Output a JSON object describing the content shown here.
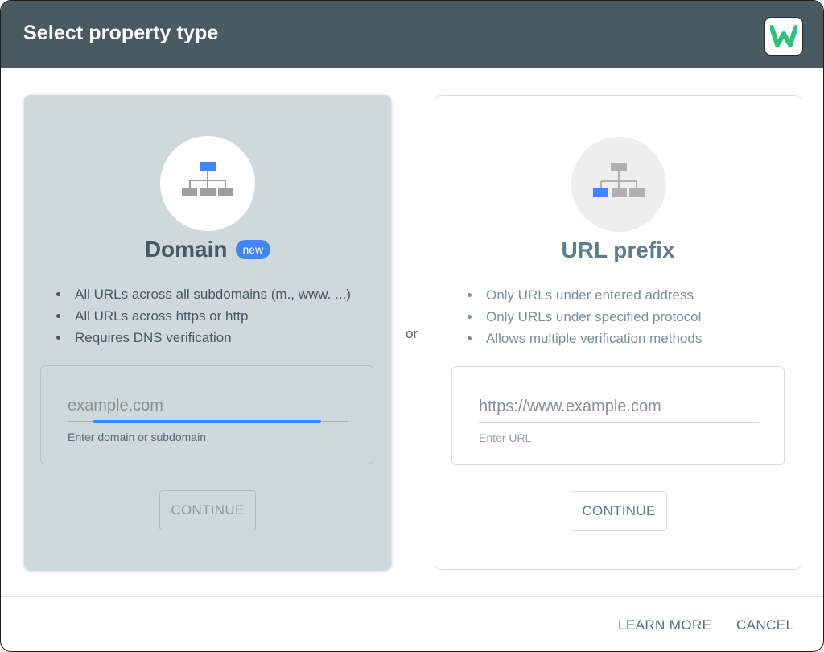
{
  "dialog": {
    "title": "Select property type",
    "logo_icon": "wm-logo-icon"
  },
  "domain_card": {
    "icon": "sitemap-icon",
    "title": "Domain",
    "badge": "new",
    "bullets": [
      "All URLs across all subdomains (m., www. ...)",
      "All URLs across https or http",
      "Requires DNS verification"
    ],
    "input_placeholder": "example.com",
    "input_value": "",
    "helper": "Enter domain or subdomain",
    "continue_label": "CONTINUE"
  },
  "separator": "or",
  "url_card": {
    "icon": "sitemap-icon",
    "title": "URL prefix",
    "bullets": [
      "Only URLs under entered address",
      "Only URLs under specified protocol",
      "Allows multiple verification methods"
    ],
    "input_placeholder": "https://www.example.com",
    "input_value": "",
    "helper": "Enter URL",
    "continue_label": "CONTINUE"
  },
  "footer": {
    "learn_more": "LEARN MORE",
    "cancel": "CANCEL"
  },
  "colors": {
    "header": "#4a5a62",
    "selected_card": "#cfd8dc",
    "accent": "#4285f4"
  }
}
